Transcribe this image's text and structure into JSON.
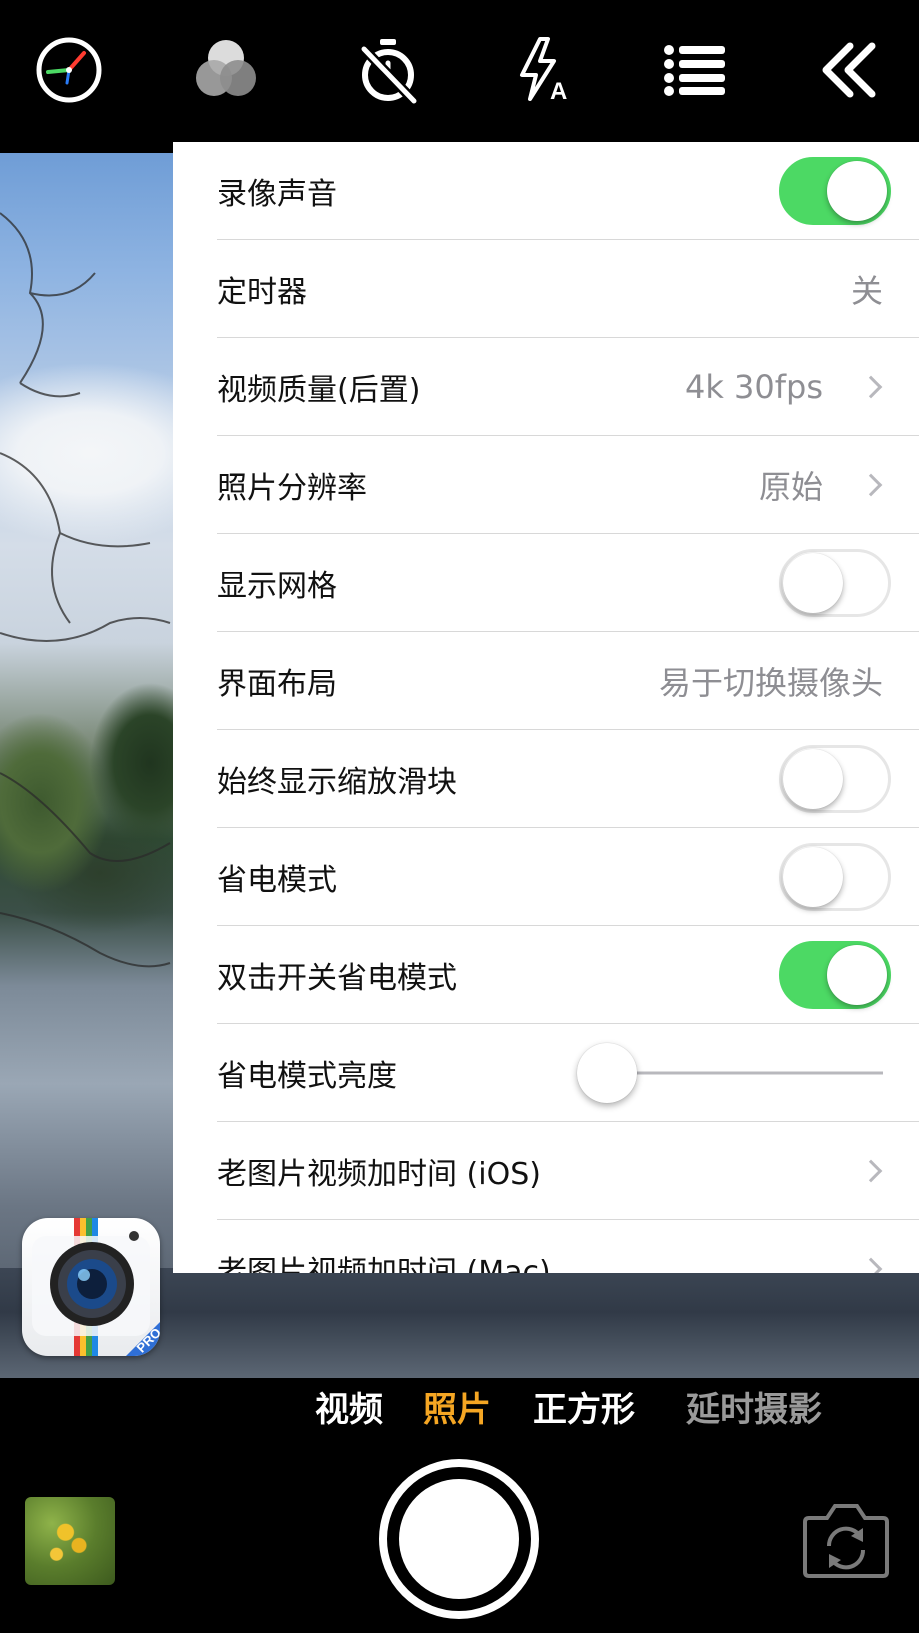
{
  "toolbar": {
    "icons": [
      "exposure-dial-icon",
      "color-filter-icon",
      "timer-off-icon",
      "flash-auto-icon",
      "menu-list-icon",
      "collapse-double-chevron-icon"
    ]
  },
  "settings": {
    "rows": [
      {
        "label": "录像声音",
        "control": "toggle",
        "on": true
      },
      {
        "label": "定时器",
        "value": "关"
      },
      {
        "label": "视频质量(后置)",
        "value": "4k 30fps",
        "chevron": true
      },
      {
        "label": "照片分辨率",
        "value": "原始",
        "chevron": true
      },
      {
        "label": "显示网格",
        "control": "toggle",
        "on": false
      },
      {
        "label": "界面布局",
        "value": "易于切换摄像头"
      },
      {
        "label": "始终显示缩放滑块",
        "control": "toggle",
        "on": false
      },
      {
        "label": "省电模式",
        "control": "toggle",
        "on": false
      },
      {
        "label": "双击开关省电模式",
        "control": "toggle",
        "on": true
      },
      {
        "label": "省电模式亮度",
        "control": "slider",
        "level": 0.0
      },
      {
        "label": "老图片视频加时间 (iOS)",
        "chevron": true
      },
      {
        "label": "老图片视频加时间 (Mac)",
        "chevron": true
      }
    ]
  },
  "modes": {
    "video": "视频",
    "photo": "照片",
    "square": "正方形",
    "timelapse": "延时摄影",
    "selected": "photo"
  },
  "app_badge": "PRO",
  "colors": {
    "toggle_on": "#4cd964",
    "mode_active": "#f5a623",
    "secondary_text": "#8e8e93"
  }
}
